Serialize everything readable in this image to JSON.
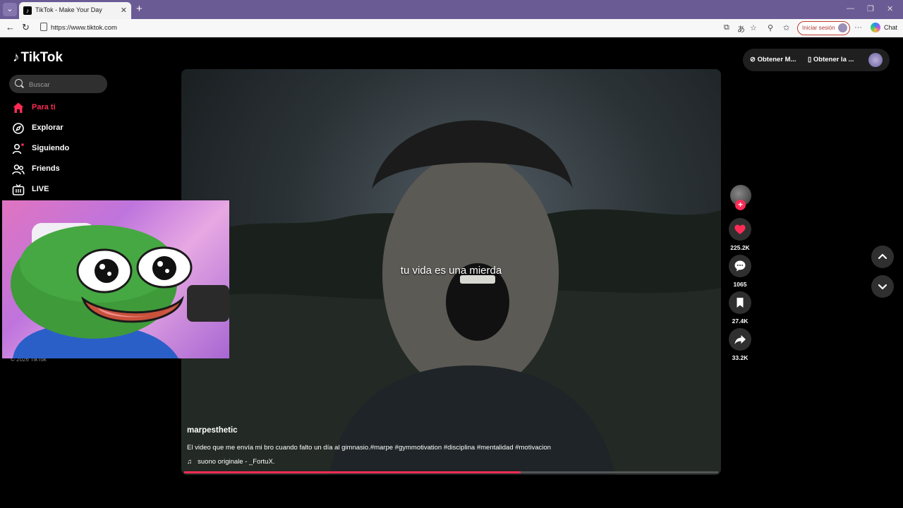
{
  "browser": {
    "tab_title": "TikTok - Make Your Day",
    "url": "https://www.tiktok.com",
    "signin_label": "Iniciar sesión",
    "chat_label": "Chat"
  },
  "sidebar": {
    "logo": "TikTok",
    "search_placeholder": "Buscar",
    "items": [
      {
        "label": "Para ti",
        "icon": "home-icon",
        "active": true
      },
      {
        "label": "Explorar",
        "icon": "compass-icon"
      },
      {
        "label": "Siguiendo",
        "icon": "following-icon"
      },
      {
        "label": "Friends",
        "icon": "friends-icon"
      },
      {
        "label": "LIVE",
        "icon": "live-icon"
      }
    ],
    "copyright": "© 2026 TikTok"
  },
  "header": {
    "get_coins": "Obtener M...",
    "get_app": "Obtener la ..."
  },
  "video": {
    "overlay_text": "tu vida es una mierda",
    "username": "marpesthetic",
    "description": "El video que me envía mi bro cuando falto un día al gimnasio.#marpe #gymmotivation #disciplina #mentalidad #motivacion",
    "music": "suono originale - _FortuX.",
    "progress": 0.63
  },
  "actions": {
    "likes": "225.2K",
    "comments": "1065",
    "saves": "27.4K",
    "shares": "33.2K"
  },
  "colors": {
    "accent": "#fe2c55",
    "browser_frame": "#6b5b95"
  }
}
